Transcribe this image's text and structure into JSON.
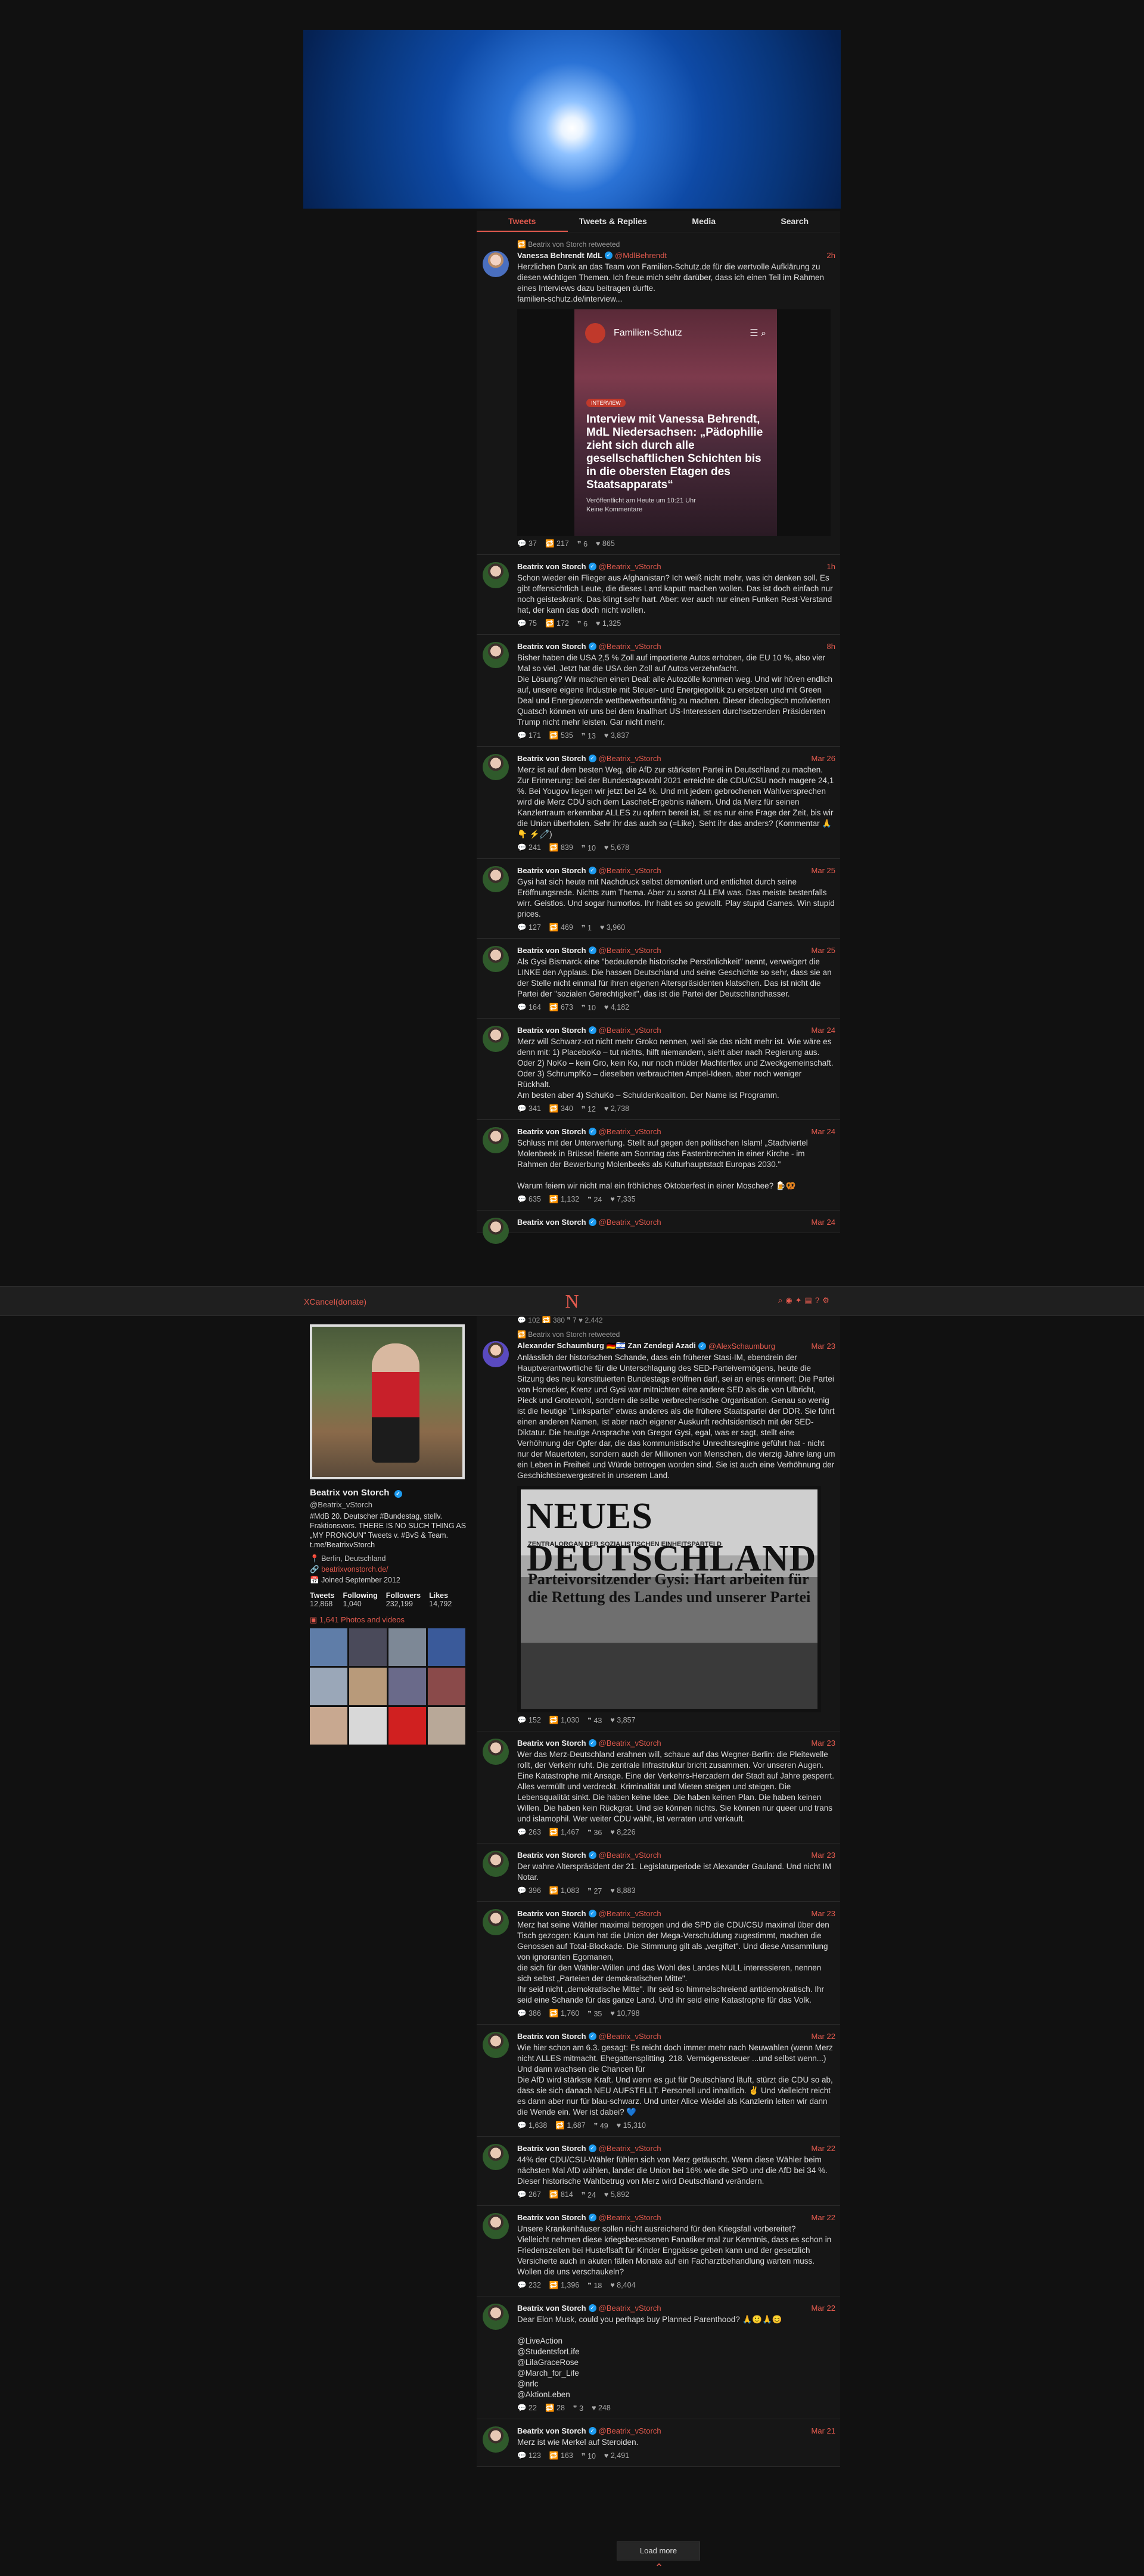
{
  "tabs": [
    "Tweets",
    "Tweets & Replies",
    "Media",
    "Search"
  ],
  "topbar": {
    "brand": "XCancel",
    "donate": "(donate)",
    "logo": "N"
  },
  "card": {
    "brand": "Familien-Schutz",
    "tag": "INTERVIEW",
    "headline": "Interview mit Vanessa Behrendt, MdL Niedersachsen: „Pädophilie zieht sich durch alle gesellschaftlichen Schichten bis in die obersten Etagen des Staatsapparats“",
    "meta1": "Veröffentlicht am Heute um 10:21 Uhr",
    "meta2": "Keine Kommentare"
  },
  "newspaper": {
    "title": "NEUES DEUTSCHLAND",
    "sub": "ZENTRALORGAN DER SOZIALISTISCHEN EINHEITSPARTEI D",
    "head": "Parteivorsitzender Gysi: Hart arbeiten für die Rettung des Landes und unserer Partei"
  },
  "tweets1": [
    {
      "rt": "Beatrix von Storch retweeted",
      "name": "Vanessa Behrendt MdL",
      "handle": "@MdlBehrendt",
      "date": "2h",
      "avatar": "blue",
      "text": "Herzlichen Dank an das Team von Familien-Schutz.de für die wertvolle Aufklärung zu diesen wichtigen Themen. Ich freue mich sehr darüber, dass ich einen Teil im Rahmen eines Interviews dazu beitragen durfte.\nfamilien-schutz.de/interview...",
      "c": "37",
      "r": "217",
      "q": "6",
      "l": "865",
      "card": true
    },
    {
      "name": "Beatrix von Storch",
      "handle": "@Beatrix_vStorch",
      "date": "1h",
      "avatar": "green",
      "text": "Schon wieder ein Flieger aus Afghanistan? Ich weiß nicht mehr, was ich denken soll. Es gibt offensichtlich Leute, die dieses Land kaputt machen wollen. Das ist doch einfach nur noch geisteskrank. Das klingt sehr hart. Aber: wer auch nur einen Funken Rest-Verstand hat, der kann das doch nicht wollen.",
      "c": "75",
      "r": "172",
      "q": "6",
      "l": "1,325"
    },
    {
      "name": "Beatrix von Storch",
      "handle": "@Beatrix_vStorch",
      "date": "8h",
      "avatar": "green",
      "text": "Bisher haben die USA 2,5 % Zoll auf importierte Autos erhoben, die EU 10 %, also vier Mal so viel. Jetzt hat die USA den Zoll auf Autos verzehnfacht.\nDie Lösung? Wir machen einen Deal: alle Autozölle kommen weg. Und wir hören endlich auf, unsere eigene Industrie mit Steuer- und Energiepolitik zu ersetzen und mit Green Deal und Energiewende wettbewerbsunfähig zu machen. Dieser ideologisch motivierten Quatsch können wir uns bei dem knallhart US-Interessen durchsetzenden Präsidenten Trump nicht mehr leisten. Gar nicht mehr.",
      "c": "171",
      "r": "535",
      "q": "13",
      "l": "3,837"
    },
    {
      "name": "Beatrix von Storch",
      "handle": "@Beatrix_vStorch",
      "date": "Mar 26",
      "avatar": "green",
      "text": "Merz ist auf dem besten Weg, die AfD zur stärksten Partei in Deutschland zu machen. Zur Erinnerung: bei der Bundestagswahl 2021 erreichte die CDU/CSU noch magere 24,1 %. Bei Yougov liegen wir jetzt bei 24 %. Und mit jedem gebrochenen Wahlversprechen wird die Merz CDU sich dem Laschet-Ergebnis nähern. Und da Merz für seinen Kanzlertraum erkennbar ALLES zu opfern bereit ist, ist es nur eine Frage der Zeit, bis wir die Union überholen. Sehr ihr das auch so (=Like). Seht ihr das anders? (Kommentar 🙏👇 ⚡🧷)",
      "c": "241",
      "r": "839",
      "q": "10",
      "l": "5,678"
    },
    {
      "name": "Beatrix von Storch",
      "handle": "@Beatrix_vStorch",
      "date": "Mar 25",
      "avatar": "green",
      "text": "Gysi hat sich heute mit Nachdruck selbst demontiert und entlichtet durch seine Eröffnungsrede. Nichts zum Thema. Aber zu sonst ALLEM was. Das meiste bestenfalls wirr. Geistlos. Und sogar humorlos. Ihr habt es so gewollt. Play stupid Games. Win stupid prices.",
      "c": "127",
      "r": "469",
      "q": "1",
      "l": "3,960"
    },
    {
      "name": "Beatrix von Storch",
      "handle": "@Beatrix_vStorch",
      "date": "Mar 25",
      "avatar": "green",
      "text": "Als Gysi Bismarck eine \"bedeutende historische Persönlichkeit\" nennt, verweigert die LINKE den Applaus. Die hassen Deutschland und seine Geschichte so sehr, dass sie an der Stelle nicht einmal für ihren eigenen Alterspräsidenten klatschen. Das ist nicht die Partei der \"sozialen Gerechtigkeit\", das ist die Partei der Deutschlandhasser.",
      "c": "164",
      "r": "673",
      "q": "10",
      "l": "4,182"
    },
    {
      "name": "Beatrix von Storch",
      "handle": "@Beatrix_vStorch",
      "date": "Mar 24",
      "avatar": "green",
      "text": "Merz will Schwarz-rot nicht mehr Groko nennen, weil sie das nicht mehr ist. Wie wäre es denn mit: 1) PlaceboKo – tut nichts, hilft niemandem, sieht aber nach Regierung aus.\nOder 2) NoKo – kein Gro, kein Ko, nur noch müder Machterflex und Zweckgemeinschaft.\nOder 3) SchrumpfKo – dieselben verbrauchten Ampel-Ideen, aber noch weniger Rückhalt.\nAm besten aber 4) SchuKo – Schuldenkoalition. Der Name ist Programm.",
      "c": "341",
      "r": "340",
      "q": "12",
      "l": "2,738"
    },
    {
      "name": "Beatrix von Storch",
      "handle": "@Beatrix_vStorch",
      "date": "Mar 24",
      "avatar": "green",
      "text": "Schluss mit der Unterwerfung. Stellt auf gegen den politischen Islam! „Stadtviertel Molenbeek in Brüssel feierte am Sonntag das Fastenbrechen in einer Kirche - im Rahmen der Bewerbung Molenbeeks als Kulturhauptstadt Europas 2030.\"\n\nWarum feiern wir nicht mal ein fröhliches Oktoberfest in einer Moschee? 🍺🥨",
      "c": "635",
      "r": "1,132",
      "q": "24",
      "l": "7,335"
    },
    {
      "name": "Beatrix von Storch",
      "handle": "@Beatrix_vStorch",
      "date": "Mar 24",
      "avatar": "green",
      "text": "",
      "c": "",
      "r": "",
      "q": "",
      "l": ""
    }
  ],
  "cut_stats": "💬 102   🔁 380   ❞ 7   ♥ 2,442",
  "profile": {
    "name": "Beatrix von Storch",
    "handle": "@Beatrix_vStorch",
    "bio": "#MdB 20. Deutscher #Bundestag, stellv. Fraktionsvors. THERE IS NO SUCH THING AS „MY PRONOUN\" Tweets v. #BvS & Team. t.me/BeatrixvStorch",
    "location": "Berlin, Deutschland",
    "website": "beatrixvonstorch.de/",
    "joined": "Joined September 2012",
    "stats": [
      {
        "label": "Tweets",
        "value": "12,868"
      },
      {
        "label": "Following",
        "value": "1,040"
      },
      {
        "label": "Followers",
        "value": "232,199"
      },
      {
        "label": "Likes",
        "value": "14,792"
      }
    ],
    "photos_label": "1,641 Photos and videos"
  },
  "tweets2": [
    {
      "rt": "Beatrix von Storch retweeted",
      "name": "Alexander Schaumburg 🇩🇪🇮🇱 Zan Zendegi Azadi",
      "handle": "@AlexSchaumburg",
      "date": "Mar 23",
      "avatar": "purple",
      "text": "Anlässlich der historischen Schande, dass ein früherer Stasi-IM, ebendrein der Hauptverantwortliche für die Unterschlagung des SED-Parteivermögens, heute die Sitzung des neu konstituierten Bundestags eröffnen darf, sei an eines erinnert: Die Partei von Honecker, Krenz und Gysi war mitnichten eine andere SED als die von Ulbricht, Pieck und Grotewohl, sondern die selbe verbrecherische Organisation. Genau so wenig ist die heutige \"Linkspartei\" etwas anderes als die frühere Staatspartei der DDR. Sie führt einen anderen Namen, ist aber nach eigener Auskunft rechtsidentisch mit der SED-Diktatur. Die heutige Ansprache von Gregor Gysi, egal, was er sagt, stellt eine Verhöhnung der Opfer dar, die das kommunistische Unrechtsregime geführt hat - nicht nur der Mauertoten, sondern auch der Millionen von Menschen, die vierzig Jahre lang um ein Leben in Freiheit und Würde betrogen worden sind. Sie ist auch eine Verhöhnung der Geschichtsbewergestreit in unserem Land.",
      "c": "152",
      "r": "1,030",
      "q": "43",
      "l": "3,857",
      "newspaper": true
    },
    {
      "name": "Beatrix von Storch",
      "handle": "@Beatrix_vStorch",
      "date": "Mar 23",
      "avatar": "green",
      "text": "Wer das Merz-Deutschland erahnen will, schaue auf das Wegner-Berlin: die Pleitewelle rollt, der Verkehr ruht. Die zentrale Infrastruktur bricht zusammen. Vor unseren Augen. Eine Katastrophe mit Ansage. Eine der Verkehrs-Herzadern der Stadt auf Jahre gesperrt. Alles vermüllt und verdreckt. Kriminalität und Mieten steigen und steigen. Die Lebensqualität sinkt. Die haben keine Idee. Die haben keinen Plan. Die haben keinen Willen. Die haben kein Rückgrat. Und sie können nichts. Sie können nur queer und trans und islamophil. Wer weiter CDU wählt, ist verraten und verkauft.",
      "c": "263",
      "r": "1,467",
      "q": "36",
      "l": "8,226"
    },
    {
      "name": "Beatrix von Storch",
      "handle": "@Beatrix_vStorch",
      "date": "Mar 23",
      "avatar": "green",
      "text": "Der wahre Alterspräsident der 21. Legislaturperiode ist Alexander Gauland. Und nicht IM Notar.",
      "c": "396",
      "r": "1,083",
      "q": "27",
      "l": "8,883"
    },
    {
      "name": "Beatrix von Storch",
      "handle": "@Beatrix_vStorch",
      "date": "Mar 23",
      "avatar": "green",
      "text": "Merz hat seine Wähler maximal betrogen und die SPD die CDU/CSU maximal über den Tisch gezogen: Kaum hat die Union der Mega-Verschuldung zugestimmt, machen die Genossen auf Total-Blockade. Die Stimmung gilt als „vergiftet\". Und diese Ansammlung von ignoranten Egomanen,\ndie sich für den Wähler-Willen und das Wohl des Landes NULL interessieren, nennen sich selbst „Parteien der demokratischen Mitte\".\nIhr seid nicht „demokratische Mitte\". Ihr seid so himmelschreiend antidemokratisch. Ihr seid eine Schande für das ganze Land. Und ihr seid eine Katastrophe für das Volk.",
      "c": "386",
      "r": "1,760",
      "q": "35",
      "l": "10,798"
    },
    {
      "name": "Beatrix von Storch",
      "handle": "@Beatrix_vStorch",
      "date": "Mar 22",
      "avatar": "green",
      "text": "Wie hier schon am 6.3. gesagt: Es reicht doch immer mehr nach Neuwahlen (wenn Merz nicht ALLES mitmacht. Ehegattensplitting. 218. Vermögenssteuer ...und selbst wenn...) Und dann wachsen die Chancen für\nDie AfD wird stärkste Kraft. Und wenn es gut für Deutschland läuft, stürzt die CDU so ab, dass sie sich danach NEU AUFSTELLT. Personell und inhaltlich. ✌️ Und vielleicht reicht es dann aber nur für blau-schwarz. Und unter Alice Weidel als Kanzlerin leiten wir dann die Wende ein. Wer ist dabei? 💙",
      "c": "1,638",
      "r": "1,687",
      "q": "49",
      "l": "15,310"
    },
    {
      "name": "Beatrix von Storch",
      "handle": "@Beatrix_vStorch",
      "date": "Mar 22",
      "avatar": "green",
      "text": "44% der CDU/CSU-Wähler fühlen sich von Merz getäuscht. Wenn diese Wähler beim nächsten Mal AfD wählen, landet die Union bei 16% wie die SPD und die AfD bei 34 %. Dieser historische Wahlbetrug von Merz wird Deutschland verändern.",
      "c": "267",
      "r": "814",
      "q": "24",
      "l": "5,892"
    },
    {
      "name": "Beatrix von Storch",
      "handle": "@Beatrix_vStorch",
      "date": "Mar 22",
      "avatar": "green",
      "text": "Unsere Krankenhäuser sollen nicht ausreichend für den Kriegsfall vorbereitet?\nVielleicht nehmen diese kriegsbesessenen Fanatiker mal zur Kenntnis, dass es schon in Friedenszeiten bei Husteflsaft für Kinder Engpässe geben kann und der gesetzlich Versicherte auch in akuten fällen Monate auf ein Facharztbehandlung warten muss. Wollen die uns verschaukeln?",
      "c": "232",
      "r": "1,396",
      "q": "18",
      "l": "8,404"
    },
    {
      "name": "Beatrix von Storch",
      "handle": "@Beatrix_vStorch",
      "date": "Mar 22",
      "avatar": "green",
      "text": "Dear Elon Musk, could you perhaps buy Planned Parenthood? 🙏🙂🙏😊\n\n@LiveAction\n@StudentsforLife\n@LilaGraceRose\n@March_for_Life\n@nrlc\n@AktionLeben",
      "c": "22",
      "r": "28",
      "q": "3",
      "l": "248"
    },
    {
      "name": "Beatrix von Storch",
      "handle": "@Beatrix_vStorch",
      "date": "Mar 21",
      "avatar": "green",
      "text": "Merz ist wie Merkel auf Steroiden.",
      "c": "123",
      "r": "163",
      "q": "10",
      "l": "2,491"
    }
  ],
  "load_more": "Load more",
  "colors": {
    "accent": "#e25a4e",
    "bg": "#111111",
    "card": "#161616"
  }
}
